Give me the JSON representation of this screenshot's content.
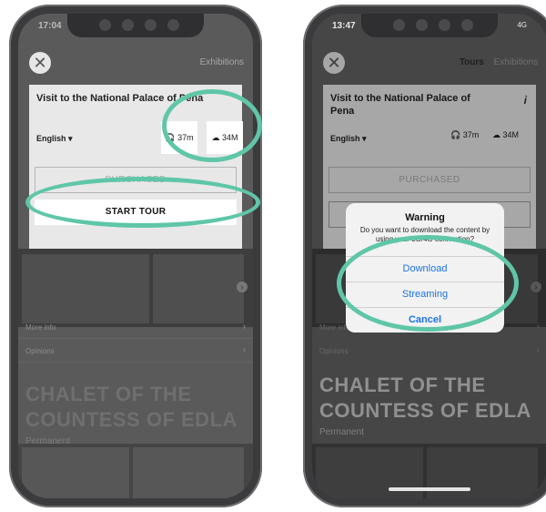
{
  "left_phone": {
    "status_time": "17:04",
    "tabs": [
      "Exhibitions"
    ],
    "card_title": "Visit to the National Palace of Pena",
    "language": "English",
    "audio_duration": "37m",
    "download_size": "34M",
    "purchased_label": "PURCHASED",
    "start_tour_label": "START TOUR",
    "menu": [
      "More info",
      "Opinions"
    ],
    "title": "CHALET OF THE COUNTESS OF EDLA",
    "subtitle": "Permanent"
  },
  "right_phone": {
    "status_time": "13:47",
    "status_icons": "4G",
    "tabs": [
      "Tours",
      "Exhibitions"
    ],
    "card_title": "Visit to the National Palace of Pena",
    "info_icon": "i",
    "language": "English",
    "audio_duration": "37m",
    "download_size": "34M",
    "purchased_label": "PURCHASED",
    "menu": [
      "More info",
      "Opinions"
    ],
    "title": "CHALET OF THE COUNTESS OF EDLA",
    "subtitle": "Permanent",
    "alert": {
      "title": "Warning",
      "message": "Do you want to download the content by using your 3G/4G connection?",
      "download": "Download",
      "streaming": "Streaming",
      "cancel": "Cancel"
    }
  },
  "colors": {
    "highlight_ring": "#5fc6a8",
    "alert_button": "#1a73e8"
  }
}
